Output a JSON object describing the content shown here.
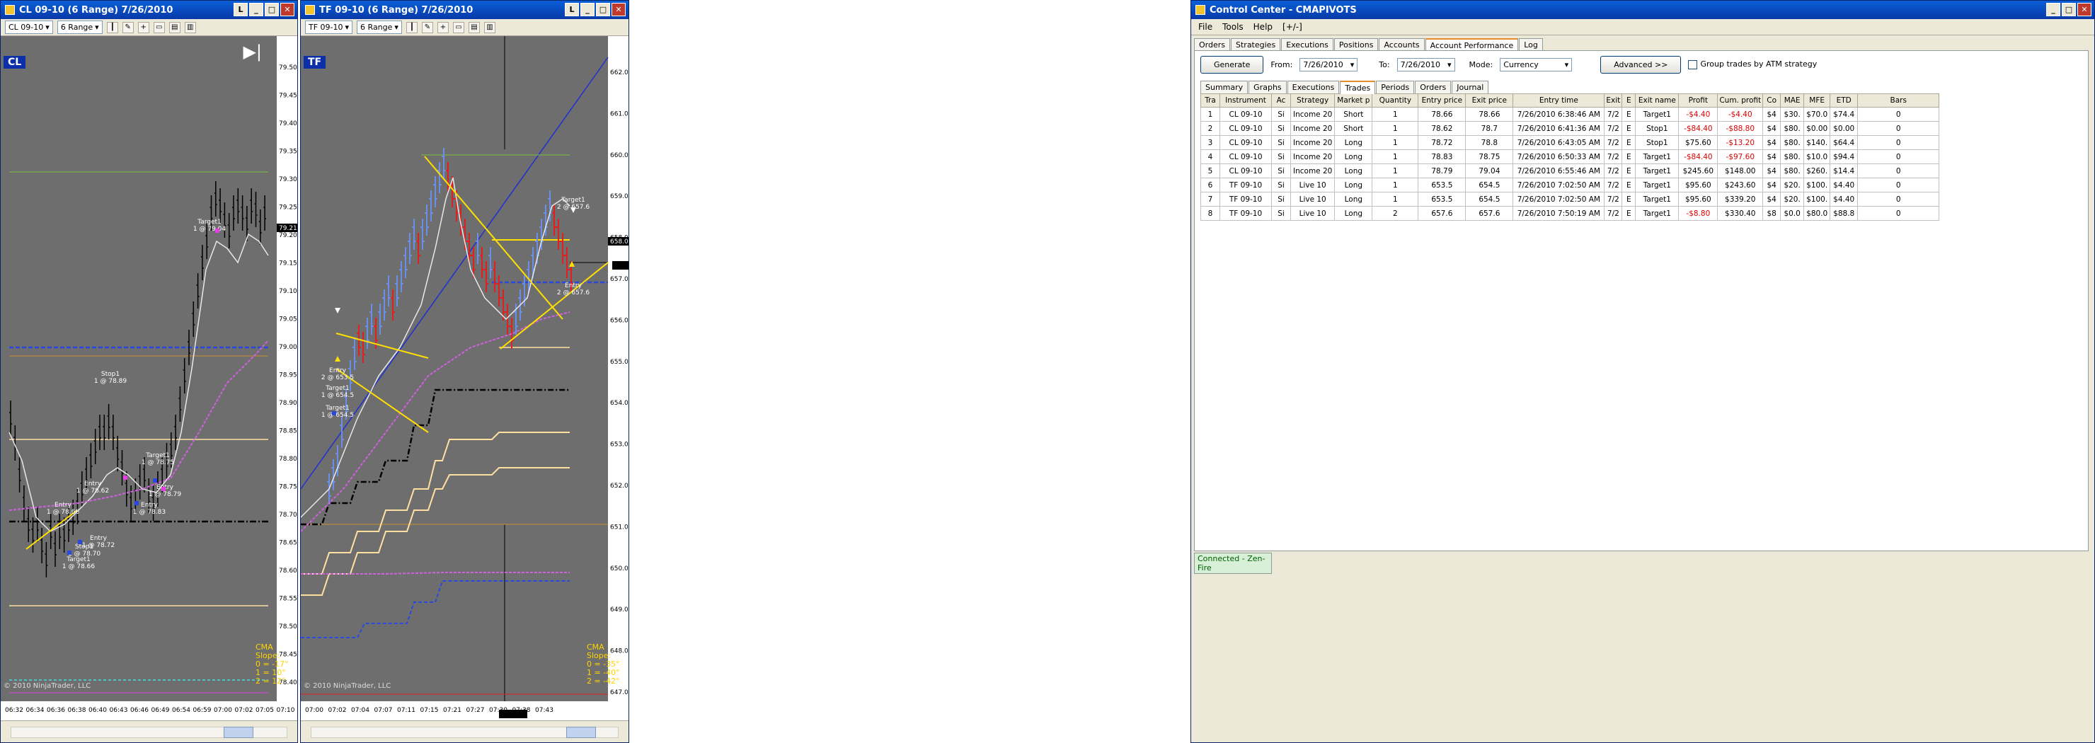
{
  "cl_window": {
    "title": "CL 09-10 (6 Range)  7/26/2010",
    "instrument": "CL 09-10",
    "range": "6 Range",
    "badge": "CL",
    "value_marker": "79.21",
    "copyright": "© 2010 NinjaTrader, LLC",
    "slope_title": "CMA Slope:",
    "slope_lines": [
      "0 = -17°",
      "1 = 10°",
      "2 = 12°"
    ],
    "price_axis": [
      "79.50",
      "79.45",
      "79.40",
      "79.35",
      "79.30",
      "79.25",
      "79.20",
      "79.15",
      "79.10",
      "79.05",
      "79.00",
      "78.95",
      "78.90",
      "78.85",
      "78.80",
      "78.75",
      "78.70",
      "78.65",
      "78.60",
      "78.55",
      "78.50",
      "78.45",
      "78.40"
    ],
    "time_axis": [
      "06:32",
      "06:34",
      "06:36",
      "06:38",
      "06:40",
      "06:43",
      "06:46",
      "06:49",
      "06:54",
      "06:59",
      "07:00",
      "07:02",
      "07:05",
      "07:10"
    ],
    "annotations": [
      {
        "lines": [
          "Target1",
          "1 @ 79.04"
        ]
      },
      {
        "lines": [
          "Stop1",
          "1 @ 78.89"
        ]
      },
      {
        "lines": [
          "Target1",
          "1 @ 78.75"
        ]
      },
      {
        "lines": [
          "Entry",
          "1 @ 78.62"
        ]
      },
      {
        "lines": [
          "Entry",
          "1 @ 78.66"
        ]
      },
      {
        "lines": [
          "Entry",
          "1 @ 78.83"
        ]
      },
      {
        "lines": [
          "Entry",
          "1 @ 78.79"
        ]
      },
      {
        "lines": [
          "Entry",
          "1 @ 78.72"
        ]
      },
      {
        "lines": [
          "Stop1",
          "1 @ 78.70"
        ]
      },
      {
        "lines": [
          "Target1",
          "1 @ 78.66"
        ]
      }
    ]
  },
  "tf_window": {
    "title": "TF 09-10 (6 Range)  7/26/2010",
    "instrument": "TF 09-10",
    "range": "6 Range",
    "badge": "TF",
    "value_marker": "658.0",
    "copyright": "© 2010 NinjaTrader, LLC",
    "slope_title": "CMA Slope:",
    "slope_lines": [
      "0 = -35°",
      "1 = -40°",
      "2 = -42°"
    ],
    "price_axis": [
      "662.0",
      "661.0",
      "660.0",
      "659.0",
      "658.0",
      "657.0",
      "656.0",
      "655.0",
      "654.0",
      "653.0",
      "652.0",
      "651.0",
      "650.0",
      "649.0",
      "648.0",
      "647.0"
    ],
    "time_axis": [
      "07:00",
      "07:02",
      "07:04",
      "07:07",
      "07:11",
      "07:15",
      "07:21",
      "07:27",
      "07:30",
      "07:38",
      "07:43"
    ],
    "annotations": [
      {
        "lines": [
          "Target1",
          "2 @ 657.6"
        ]
      },
      {
        "lines": [
          "Entry",
          "2 @ 657.6"
        ]
      },
      {
        "lines": [
          "Entry",
          "2 @ 653.5"
        ]
      },
      {
        "lines": [
          "Target1",
          "1 @ 654.5"
        ]
      },
      {
        "lines": [
          "Target1",
          "1 @ 654.5"
        ]
      }
    ]
  },
  "control_center": {
    "title": "Control Center - CMAPIVOTS",
    "menu": [
      "File",
      "Tools",
      "Help",
      "[+/-]"
    ],
    "top_tabs": [
      "Orders",
      "Strategies",
      "Executions",
      "Positions",
      "Accounts",
      "Account Performance",
      "Log"
    ],
    "active_top_tab": "Account Performance",
    "generate_label": "Generate",
    "from_label": "From:",
    "from_value": "7/26/2010",
    "to_label": "To:",
    "to_value": "7/26/2010",
    "mode_label": "Mode:",
    "mode_value": "Currency",
    "advanced_label": "Advanced >>",
    "atm_label": "Group trades by ATM strategy",
    "sub_tabs": [
      "Summary",
      "Graphs",
      "Executions",
      "Trades",
      "Periods",
      "Orders",
      "Journal"
    ],
    "active_sub_tab": "Trades",
    "columns": [
      "Tra",
      "Instrument",
      "Ac",
      "Strategy",
      "Market p",
      "Quantity",
      "Entry price",
      "Exit price",
      "Entry time",
      "Exit",
      "E",
      "Exit name",
      "Profit",
      "Cum. profit",
      "Co",
      "MAE",
      "MFE",
      "ETD",
      "Bars"
    ],
    "rows": [
      [
        "1",
        "CL 09-10",
        "Si",
        "Income 20",
        "Short",
        "1",
        "78.66",
        "78.66",
        "7/26/2010 6:38:46 AM",
        "7/2",
        "E",
        "Target1",
        "-$4.40",
        "-$4.40",
        "$4",
        "$30.",
        "$70.0",
        "$74.4",
        "0"
      ],
      [
        "2",
        "CL 09-10",
        "Si",
        "Income 20",
        "Short",
        "1",
        "78.62",
        "78.7",
        "7/26/2010 6:41:36 AM",
        "7/2",
        "E",
        "Stop1",
        "-$84.40",
        "-$88.80",
        "$4",
        "$80.",
        "$0.00",
        "$0.00",
        "0"
      ],
      [
        "3",
        "CL 09-10",
        "Si",
        "Income 20",
        "Long",
        "1",
        "78.72",
        "78.8",
        "7/26/2010 6:43:05 AM",
        "7/2",
        "E",
        "Stop1",
        "$75.60",
        "-$13.20",
        "$4",
        "$80.",
        "$140.",
        "$64.4",
        "0"
      ],
      [
        "4",
        "CL 09-10",
        "Si",
        "Income 20",
        "Long",
        "1",
        "78.83",
        "78.75",
        "7/26/2010 6:50:33 AM",
        "7/2",
        "E",
        "Target1",
        "-$84.40",
        "-$97.60",
        "$4",
        "$80.",
        "$10.0",
        "$94.4",
        "0"
      ],
      [
        "5",
        "CL 09-10",
        "Si",
        "Income 20",
        "Long",
        "1",
        "78.79",
        "79.04",
        "7/26/2010 6:55:46 AM",
        "7/2",
        "E",
        "Target1",
        "$245.60",
        "$148.00",
        "$4",
        "$80.",
        "$260.",
        "$14.4",
        "0"
      ],
      [
        "6",
        "TF 09-10",
        "Si",
        "Live 10",
        "Long",
        "1",
        "653.5",
        "654.5",
        "7/26/2010 7:02:50 AM",
        "7/2",
        "E",
        "Target1",
        "$95.60",
        "$243.60",
        "$4",
        "$20.",
        "$100.",
        "$4.40",
        "0"
      ],
      [
        "7",
        "TF 09-10",
        "Si",
        "Live 10",
        "Long",
        "1",
        "653.5",
        "654.5",
        "7/26/2010 7:02:50 AM",
        "7/2",
        "E",
        "Target1",
        "$95.60",
        "$339.20",
        "$4",
        "$20.",
        "$100.",
        "$4.40",
        "0"
      ],
      [
        "8",
        "TF 09-10",
        "Si",
        "Live 10",
        "Long",
        "2",
        "657.6",
        "657.6",
        "7/26/2010 7:50:19 AM",
        "7/2",
        "E",
        "Target1",
        "-$8.80",
        "$330.40",
        "$8",
        "$0.0",
        "$80.0",
        "$88.8",
        "0"
      ]
    ],
    "status": "Connected - Zen-Fire"
  },
  "colors": {
    "chart_bg": "#6e6e6e",
    "title_blue": "#0a5fd8",
    "up_bar": "#6b8fe8",
    "down_bar": "#e02020",
    "yellow": "#ffe000",
    "magenta": "#d060e0"
  }
}
